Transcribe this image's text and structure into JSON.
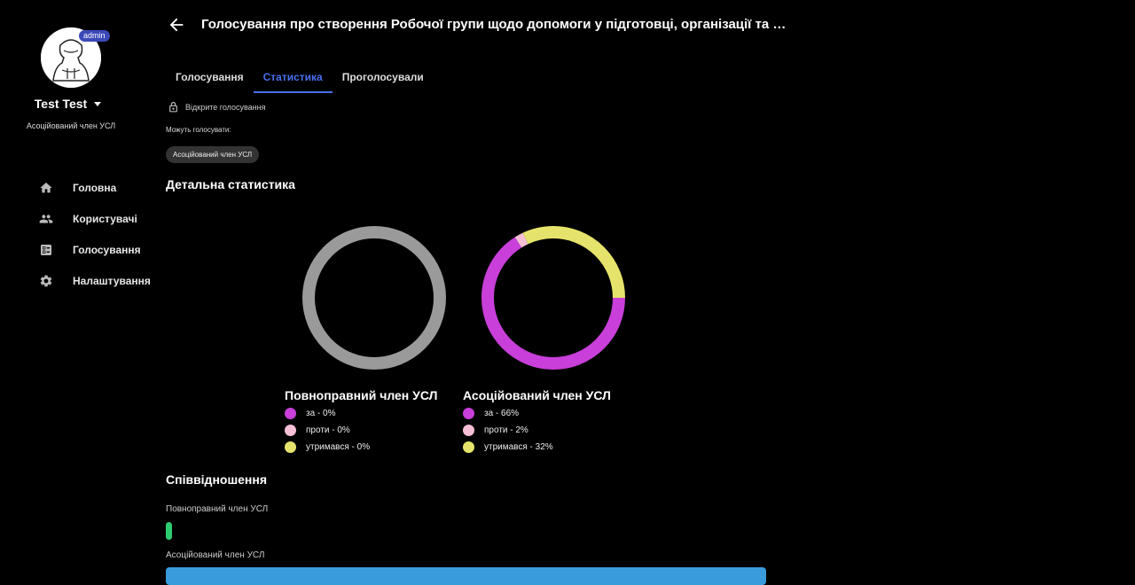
{
  "sidebar": {
    "badge": "admin",
    "user_name": "Test Test",
    "user_role": "Асоційований член УСЛ",
    "nav": [
      {
        "label": "Головна",
        "icon": "home-icon"
      },
      {
        "label": "Користувачі",
        "icon": "users-icon"
      },
      {
        "label": "Голосування",
        "icon": "ballot-icon"
      },
      {
        "label": "Налаштування",
        "icon": "gear-icon"
      }
    ]
  },
  "header": {
    "title": "Голосування про створення Робочої групи щодо допомоги у підготовці, організації та проведе…"
  },
  "tabs": [
    {
      "label": "Голосування",
      "active": false
    },
    {
      "label": "Статистика",
      "active": true
    },
    {
      "label": "Проголосували",
      "active": false
    }
  ],
  "info": {
    "open_vote": "Відкрите голосування",
    "can_vote_label": "Можуть голосувати:",
    "chip": "Асоційований член УСЛ"
  },
  "stats": {
    "title": "Детальна статистика",
    "groups": [
      {
        "name": "Повноправний член УСЛ",
        "empty": true,
        "items": [
          {
            "label": "за - 0%",
            "value": 0,
            "color": "#c83fd9"
          },
          {
            "label": "проти - 0%",
            "value": 0,
            "color": "#f6bfd6"
          },
          {
            "label": "утримався - 0%",
            "value": 0,
            "color": "#e6e36c"
          }
        ]
      },
      {
        "name": "Асоційований член УСЛ",
        "empty": false,
        "items": [
          {
            "label": "за - 66%",
            "value": 66,
            "color": "#c83fd9"
          },
          {
            "label": "проти - 2%",
            "value": 2,
            "color": "#f6bfd6"
          },
          {
            "label": "утримався - 32%",
            "value": 32,
            "color": "#e6e36c"
          }
        ]
      }
    ]
  },
  "ratio": {
    "title": "Співвідношення",
    "rows": [
      {
        "label": "Повноправний член УСЛ",
        "value": 0,
        "color": "#2ecc71"
      },
      {
        "label": "Асоційований член УСЛ",
        "value": 100,
        "color": "#3a9bdc"
      }
    ]
  },
  "colors": {
    "accent": "#4a6ff0",
    "empty_ring": "#9a9a9a"
  }
}
